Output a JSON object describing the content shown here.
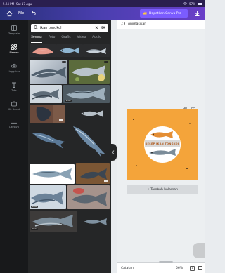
{
  "status_bar": {
    "time": "5.24 PM",
    "date": "Sat 17 Agu",
    "battery": "57%"
  },
  "toolbar": {
    "file_label": "File",
    "pro_label": "Dapatkan Canva Pro"
  },
  "rail": {
    "items": [
      {
        "icon": "template-icon",
        "label": "Template"
      },
      {
        "icon": "elements-icon",
        "label": "Elemen"
      },
      {
        "icon": "upload-icon",
        "label": "Unggahan"
      },
      {
        "icon": "text-icon",
        "label": "Teks"
      },
      {
        "icon": "brand-icon",
        "label": "Kit Brand"
      },
      {
        "icon": "more-icon",
        "label": "Lainnya"
      }
    ]
  },
  "search": {
    "value": "ikan tongkol"
  },
  "tabs": [
    "Semua",
    "Foto",
    "Grafis",
    "Video",
    "Audio"
  ],
  "badges": {
    "premium": "PRO",
    "duration": "11.0s"
  },
  "canvas": {
    "animate_label": "Animasikan",
    "design_title": "RESEP IKAN TONGKOL",
    "add_page_label": "+ Tambah halaman",
    "accent_color": "#f4a43a"
  },
  "bottom_bar": {
    "notes_label": "Catatan",
    "zoom": "56%",
    "page_number": "1"
  },
  "colors": {
    "topbar_start": "#28307a",
    "topbar_end": "#6a3fc8",
    "pro_button": "#7b5cff"
  }
}
